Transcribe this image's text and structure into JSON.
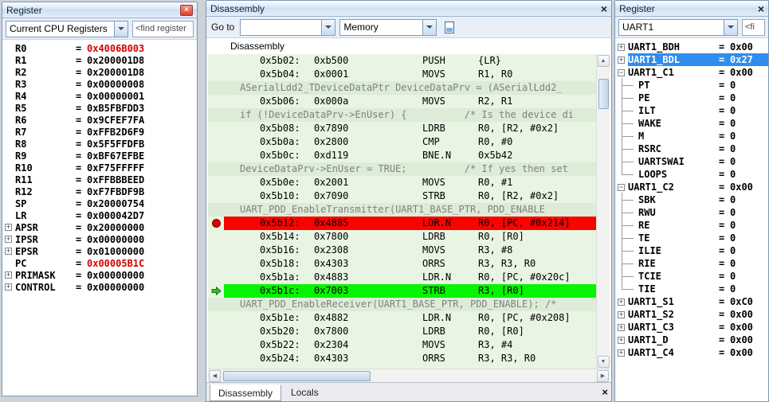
{
  "left_panel": {
    "title": "Register",
    "close_label": "×",
    "dropdown_value": "Current CPU Registers",
    "find_text": "<find register",
    "registers": [
      {
        "name": "R0",
        "value": "0x4006B003",
        "changed": true
      },
      {
        "name": "R1",
        "value": "0x200001D8"
      },
      {
        "name": "R2",
        "value": "0x200001D8"
      },
      {
        "name": "R3",
        "value": "0x00000008"
      },
      {
        "name": "R4",
        "value": "0x00000001"
      },
      {
        "name": "R5",
        "value": "0xB5FBFDD3"
      },
      {
        "name": "R6",
        "value": "0x9CFEF7FA"
      },
      {
        "name": "R7",
        "value": "0xFFB2D6F9"
      },
      {
        "name": "R8",
        "value": "0x5F5FFDFB"
      },
      {
        "name": "R9",
        "value": "0xBF67EFBE"
      },
      {
        "name": "R10",
        "value": "0xF75FFFFF"
      },
      {
        "name": "R11",
        "value": "0xFFBBBEED"
      },
      {
        "name": "R12",
        "value": "0xF7FBDF9B"
      },
      {
        "name": "SP",
        "value": "0x20000754"
      },
      {
        "name": "LR",
        "value": "0x000042D7"
      },
      {
        "name": "APSR",
        "value": "0x20000000",
        "expand": "plus"
      },
      {
        "name": "IPSR",
        "value": "0x00000000",
        "expand": "plus"
      },
      {
        "name": "EPSR",
        "value": "0x01000000",
        "expand": "plus"
      },
      {
        "name": "PC",
        "value": "0x00005B1C",
        "changed": true
      },
      {
        "name": "PRIMASK",
        "value": "0x00000000",
        "expand": "plus"
      },
      {
        "name": "CONTROL",
        "value": "0x00000000",
        "expand": "plus"
      }
    ]
  },
  "disassembly": {
    "title": "Disassembly",
    "close_label": "×",
    "goto_label": "Go to",
    "goto_value": "",
    "view_dropdown": "Memory",
    "header": "Disassembly",
    "tabs": [
      "Disassembly",
      "Locals"
    ],
    "rows": [
      {
        "type": "instr",
        "addr": "0x5b02:",
        "code": "0xb500",
        "mn": "PUSH",
        "ops": "{LR}"
      },
      {
        "type": "instr",
        "addr": "0x5b04:",
        "code": "0x0001",
        "mn": "MOVS",
        "ops": "R1, R0"
      },
      {
        "type": "source",
        "text": "ASerialLdd2_TDeviceDataPtr DeviceDataPrv = (ASerialLdd2_"
      },
      {
        "type": "instr",
        "addr": "0x5b06:",
        "code": "0x000a",
        "mn": "MOVS",
        "ops": "R2, R1"
      },
      {
        "type": "source",
        "text": "if (!DeviceDataPrv->EnUser) {          /* Is the device di"
      },
      {
        "type": "instr",
        "addr": "0x5b08:",
        "code": "0x7890",
        "mn": "LDRB",
        "ops": "R0, [R2, #0x2]"
      },
      {
        "type": "instr",
        "addr": "0x5b0a:",
        "code": "0x2800",
        "mn": "CMP",
        "ops": "R0, #0"
      },
      {
        "type": "instr",
        "addr": "0x5b0c:",
        "code": "0xd119",
        "mn": "BNE.N",
        "ops": "0x5b42"
      },
      {
        "type": "source",
        "text": "DeviceDataPrv->EnUser = TRUE;          /* If yes then set"
      },
      {
        "type": "instr",
        "addr": "0x5b0e:",
        "code": "0x2001",
        "mn": "MOVS",
        "ops": "R0, #1"
      },
      {
        "type": "instr",
        "addr": "0x5b10:",
        "code": "0x7090",
        "mn": "STRB",
        "ops": "R0, [R2, #0x2]"
      },
      {
        "type": "source",
        "text": "UART_PDD_EnableTransmitter(UART1_BASE_PTR, PDD_ENABLE"
      },
      {
        "type": "instr",
        "addr": "0x5b12:",
        "code": "0x4885",
        "mn": "LDR.N",
        "ops": "R0, [PC, #0x214]",
        "highlight": "red",
        "marker": "breakpoint"
      },
      {
        "type": "instr",
        "addr": "0x5b14:",
        "code": "0x7800",
        "mn": "LDRB",
        "ops": "R0, [R0]"
      },
      {
        "type": "instr",
        "addr": "0x5b16:",
        "code": "0x2308",
        "mn": "MOVS",
        "ops": "R3, #8"
      },
      {
        "type": "instr",
        "addr": "0x5b18:",
        "code": "0x4303",
        "mn": "ORRS",
        "ops": "R3, R3, R0"
      },
      {
        "type": "instr",
        "addr": "0x5b1a:",
        "code": "0x4883",
        "mn": "LDR.N",
        "ops": "R0, [PC, #0x20c]"
      },
      {
        "type": "instr",
        "addr": "0x5b1c:",
        "code": "0x7003",
        "mn": "STRB",
        "ops": "R3, [R0]",
        "highlight": "green",
        "marker": "pc-arrow"
      },
      {
        "type": "source",
        "text": "UART_PDD_EnableReceiver(UART1_BASE_PTR, PDD_ENABLE); /*"
      },
      {
        "type": "instr",
        "addr": "0x5b1e:",
        "code": "0x4882",
        "mn": "LDR.N",
        "ops": "R0, [PC, #0x208]"
      },
      {
        "type": "instr",
        "addr": "0x5b20:",
        "code": "0x7800",
        "mn": "LDRB",
        "ops": "R0, [R0]"
      },
      {
        "type": "instr",
        "addr": "0x5b22:",
        "code": "0x2304",
        "mn": "MOVS",
        "ops": "R3, #4"
      },
      {
        "type": "instr",
        "addr": "0x5b24:",
        "code": "0x4303",
        "mn": "ORRS",
        "ops": "R3, R3, R0"
      }
    ]
  },
  "right_panel": {
    "title": "Register",
    "close_label": "×",
    "dropdown_value": "UART1",
    "find_text": "<fi",
    "registers": [
      {
        "name": "UART1_BDH",
        "value": "0x00",
        "expand": "plus"
      },
      {
        "name": "UART1_BDL",
        "value": "0x27",
        "expand": "plus",
        "selected": true
      },
      {
        "name": "UART1_C1",
        "value": "0x00",
        "expand": "minus",
        "children": [
          {
            "name": "PT",
            "value": "0"
          },
          {
            "name": "PE",
            "value": "0"
          },
          {
            "name": "ILT",
            "value": "0"
          },
          {
            "name": "WAKE",
            "value": "0"
          },
          {
            "name": "M",
            "value": "0"
          },
          {
            "name": "RSRC",
            "value": "0"
          },
          {
            "name": "UARTSWAI",
            "value": "0"
          },
          {
            "name": "LOOPS",
            "value": "0"
          }
        ]
      },
      {
        "name": "UART1_C2",
        "value": "0x00",
        "expand": "minus",
        "children": [
          {
            "name": "SBK",
            "value": "0"
          },
          {
            "name": "RWU",
            "value": "0"
          },
          {
            "name": "RE",
            "value": "0"
          },
          {
            "name": "TE",
            "value": "0"
          },
          {
            "name": "ILIE",
            "value": "0"
          },
          {
            "name": "RIE",
            "value": "0"
          },
          {
            "name": "TCIE",
            "value": "0"
          },
          {
            "name": "TIE",
            "value": "0"
          }
        ]
      },
      {
        "name": "UART1_S1",
        "value": "0xC0",
        "expand": "plus"
      },
      {
        "name": "UART1_S2",
        "value": "0x00",
        "expand": "plus"
      },
      {
        "name": "UART1_C3",
        "value": "0x00",
        "expand": "plus"
      },
      {
        "name": "UART1_D",
        "value": "0x00",
        "expand": "plus"
      },
      {
        "name": "UART1_C4",
        "value": "0x00",
        "expand": "plus"
      }
    ]
  }
}
